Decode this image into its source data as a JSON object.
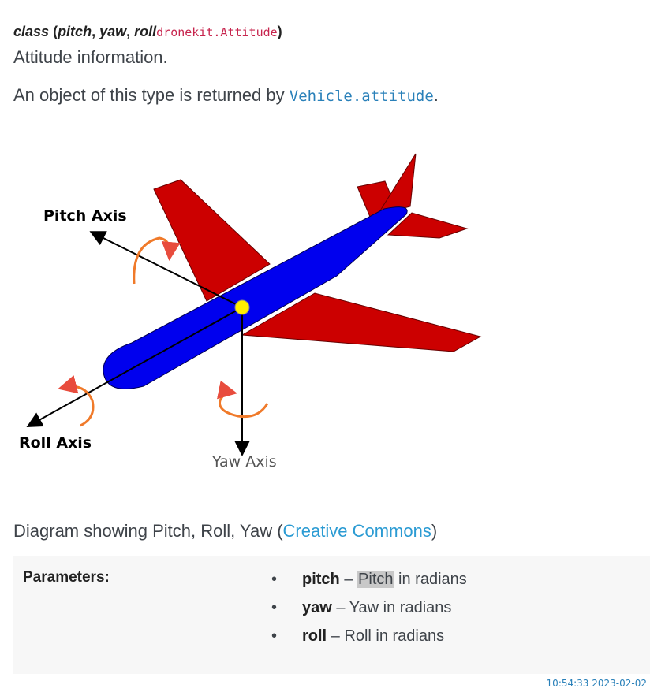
{
  "signature": {
    "keyword": "class",
    "open_paren": "(",
    "param1": "pitch",
    "sep1": ", ",
    "param2": "yaw",
    "sep2": ", ",
    "param3": "roll",
    "code": "dronekit.Attitude",
    "close_paren": ")"
  },
  "description": {
    "line1": "Attitude information.",
    "line2_prefix": "An object of this type is returned by ",
    "line2_link": "Vehicle.attitude",
    "line2_suffix": "."
  },
  "figure": {
    "pitch_label": "Pitch Axis",
    "roll_label": "Roll Axis",
    "yaw_label": "Yaw Axis",
    "colors": {
      "wings": "#cc0000",
      "fuselage": "#0000ee",
      "center": "#ffee00",
      "arrows": "#f07a2a"
    }
  },
  "caption": {
    "prefix": "Diagram showing Pitch, Roll, Yaw (",
    "link": "Creative Commons",
    "suffix": ")"
  },
  "parameters": {
    "label": "Parameters:",
    "items": [
      {
        "name": "pitch",
        "dash": " – ",
        "highlight": "Pitch",
        "rest": " in radians"
      },
      {
        "name": "yaw",
        "dash": " – ",
        "highlight": "",
        "rest": "Yaw in radians"
      },
      {
        "name": "roll",
        "dash": " – ",
        "highlight": "",
        "rest": "Roll in radians"
      }
    ],
    "bullet": "•"
  },
  "timestamp": "10:54:33 2023-02-02"
}
